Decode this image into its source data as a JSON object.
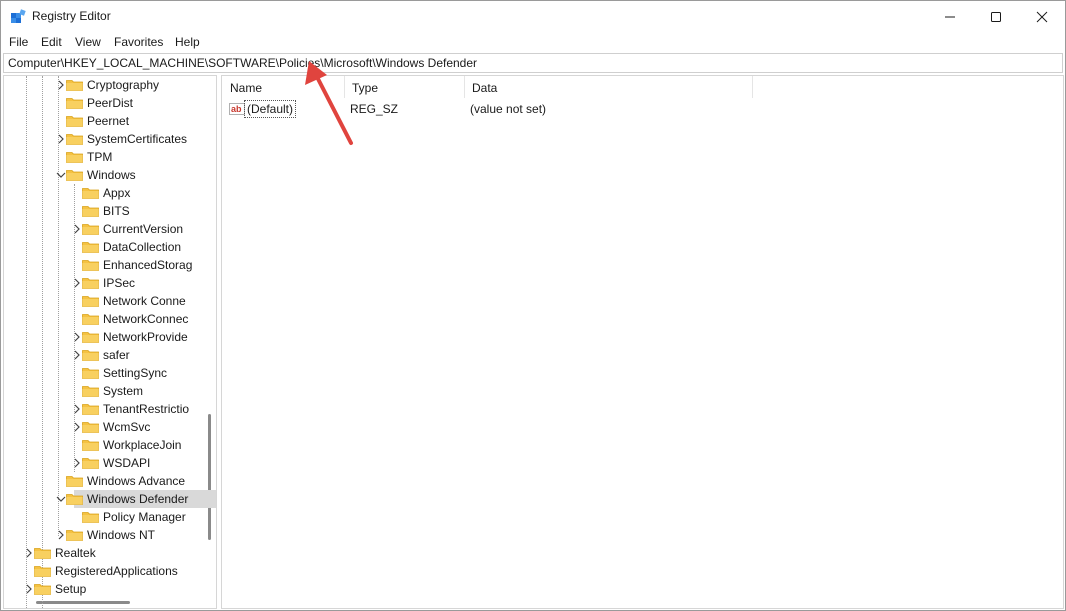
{
  "window": {
    "title": "Registry Editor",
    "menu": [
      "File",
      "Edit",
      "View",
      "Favorites",
      "Help"
    ]
  },
  "address": {
    "path": "Computer\\HKEY_LOCAL_MACHINE\\SOFTWARE\\Policies\\Microsoft\\Windows Defender"
  },
  "tree": {
    "nodes": [
      {
        "label": "Cryptography",
        "expander": "collapsed"
      },
      {
        "label": "PeerDist",
        "expander": "none"
      },
      {
        "label": "Peernet",
        "expander": "none"
      },
      {
        "label": "SystemCertificates",
        "expander": "collapsed"
      },
      {
        "label": "TPM",
        "expander": "none"
      },
      {
        "label": "Windows",
        "expander": "expanded"
      },
      {
        "label": "Appx",
        "expander": "none"
      },
      {
        "label": "BITS",
        "expander": "none"
      },
      {
        "label": "CurrentVersion",
        "expander": "collapsed"
      },
      {
        "label": "DataCollection",
        "expander": "none"
      },
      {
        "label": "EnhancedStorag",
        "expander": "none"
      },
      {
        "label": "IPSec",
        "expander": "collapsed"
      },
      {
        "label": "Network Conne",
        "expander": "none"
      },
      {
        "label": "NetworkConnec",
        "expander": "none"
      },
      {
        "label": "NetworkProvide",
        "expander": "collapsed"
      },
      {
        "label": "safer",
        "expander": "collapsed"
      },
      {
        "label": "SettingSync",
        "expander": "none"
      },
      {
        "label": "System",
        "expander": "none"
      },
      {
        "label": "TenantRestrictio",
        "expander": "collapsed"
      },
      {
        "label": "WcmSvc",
        "expander": "collapsed"
      },
      {
        "label": "WorkplaceJoin",
        "expander": "none"
      },
      {
        "label": "WSDAPI",
        "expander": "collapsed"
      },
      {
        "label": "Windows Advance",
        "expander": "none"
      },
      {
        "label": "Windows Defender",
        "expander": "expanded",
        "selected": true
      },
      {
        "label": "Policy Manager",
        "expander": "none"
      },
      {
        "label": "Windows NT",
        "expander": "collapsed"
      },
      {
        "label": "Realtek",
        "expander": "collapsed"
      },
      {
        "label": "RegisteredApplications",
        "expander": "none"
      },
      {
        "label": "Setup",
        "expander": "collapsed"
      }
    ]
  },
  "list": {
    "columns": [
      "Name",
      "Type",
      "Data"
    ],
    "rows": [
      {
        "name": "(Default)",
        "type": "REG_SZ",
        "data": "(value not set)",
        "icon": "string-value-icon"
      }
    ]
  },
  "colors": {
    "folder": "#f5c242",
    "folder_dark": "#d9a21b",
    "selection": "#d9d9d9",
    "annotation_arrow": "#e0443e"
  }
}
